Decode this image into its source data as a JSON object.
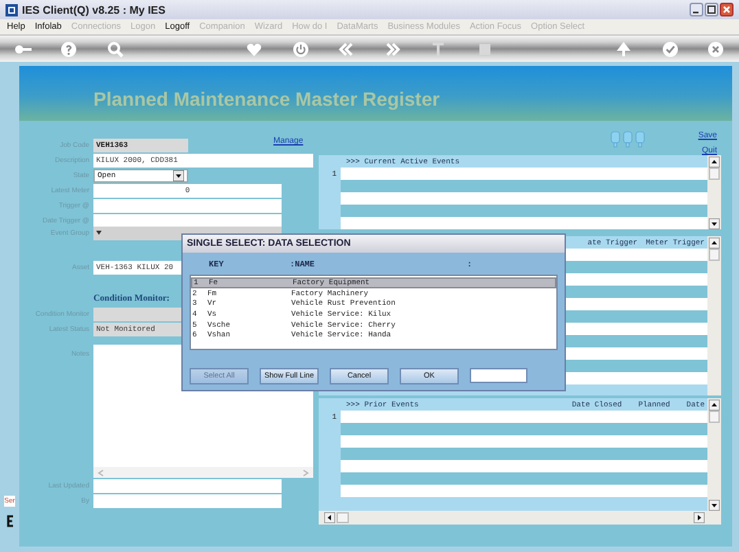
{
  "window": {
    "title": "IES Client(Q) v8.25 : My IES"
  },
  "menu": [
    {
      "label": "Help",
      "disabled": false
    },
    {
      "label": "Infolab",
      "disabled": false
    },
    {
      "label": "Connections",
      "disabled": true
    },
    {
      "label": "Logon",
      "disabled": true
    },
    {
      "label": "Logoff",
      "disabled": false
    },
    {
      "label": "Companion",
      "disabled": true
    },
    {
      "label": "Wizard",
      "disabled": true
    },
    {
      "label": "How do I",
      "disabled": true
    },
    {
      "label": "DataMarts",
      "disabled": true
    },
    {
      "label": "Business Modules",
      "disabled": true
    },
    {
      "label": "Action Focus",
      "disabled": true
    },
    {
      "label": "Option Select",
      "disabled": true
    }
  ],
  "page": {
    "title": "Planned Maintenance Master Register",
    "manage_link": "Manage",
    "links": [
      "Save",
      "Quit"
    ]
  },
  "fields": [
    {
      "label": "Job Code",
      "value": "VEH1363",
      "kind": "readonly"
    },
    {
      "label": "Description",
      "value": "KILUX 2000, CDD381",
      "kind": "long_text"
    },
    {
      "label": "State",
      "value": "Open",
      "kind": "select"
    },
    {
      "label": "Latest Meter",
      "value": "0",
      "kind": "numeric"
    },
    {
      "label": "Trigger @",
      "kind": "text"
    },
    {
      "label": "Date Trigger @",
      "kind": "text"
    },
    {
      "label": "Event Group",
      "kind": "combo"
    },
    {
      "label": "Asset",
      "value": "VEH-1363 KILUX 20",
      "kind": "long_text"
    }
  ],
  "condition_monitor": {
    "heading": "Condition Monitor:",
    "fields": [
      {
        "label": "Condition Monitor",
        "kind": "readonly"
      },
      {
        "label": "Latest Status",
        "value": "Not Monitored",
        "kind": "readonly"
      }
    ]
  },
  "notes": {
    "label": "Notes"
  },
  "audit_fields": [
    {
      "label": "Last Updated"
    },
    {
      "label": "By"
    }
  ],
  "side_tab": "Ser",
  "current_events": {
    "header": ">>> Current Active Events",
    "row_number": "1"
  },
  "trigger_events": {
    "columns": [
      "ate Trigger",
      "Meter Trigger"
    ]
  },
  "prior_events": {
    "header": ">>> Prior Events",
    "columns": [
      "Date Closed",
      "Planned",
      "Date"
    ],
    "row_number": "1"
  },
  "dialog": {
    "title": "SINGLE SELECT: DATA SELECTION",
    "columns": [
      "KEY",
      ":NAME",
      ":"
    ],
    "rows": [
      {
        "number": "1",
        "key": "Fe",
        "name": "Factory Equipment",
        "selected": true
      },
      {
        "number": "2",
        "key": "Fm",
        "name": "Factory Machinery",
        "selected": false
      },
      {
        "number": "3",
        "key": "Vr",
        "name": "Vehicle Rust Prevention",
        "selected": false
      },
      {
        "number": "4",
        "key": "Vs",
        "name": "Vehicle Service: Kilux",
        "selected": false
      },
      {
        "number": "5",
        "key": "Vsche",
        "name": "Vehicle Service: Cherry",
        "selected": false
      },
      {
        "number": "6",
        "key": "Vshan",
        "name": "Vehicle Service: Handa",
        "selected": false
      }
    ],
    "buttons": [
      {
        "label": "Select All",
        "disabled": true
      },
      {
        "label": "Show Full Line",
        "disabled": false
      },
      {
        "label": "Cancel",
        "disabled": false
      },
      {
        "label": "OK",
        "disabled": false
      }
    ]
  }
}
